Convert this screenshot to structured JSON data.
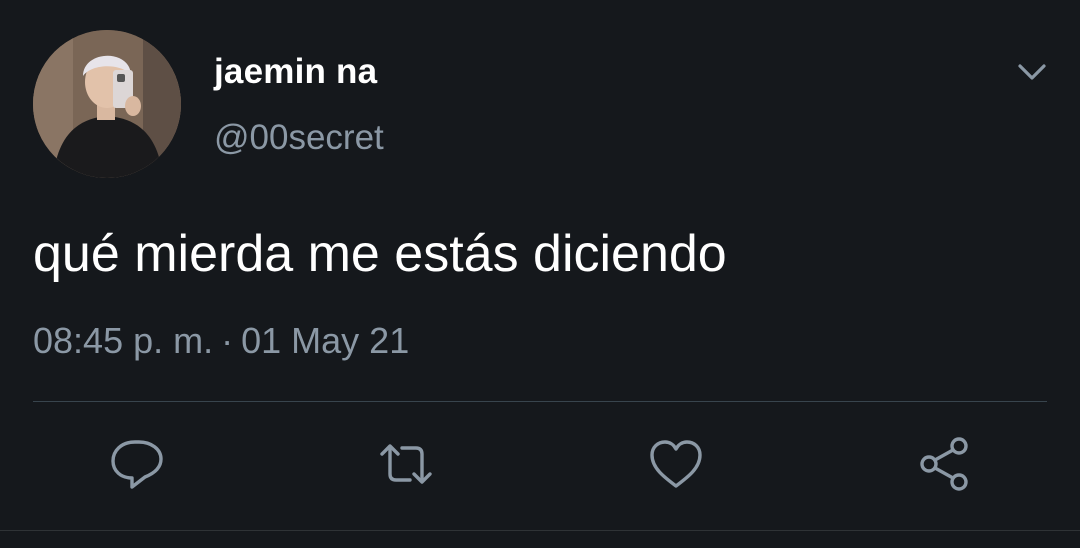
{
  "tweet": {
    "display_name": "jaemin na",
    "handle": "@00secret",
    "text": "qué mierda me estás diciendo",
    "time": "08:45 p. m.",
    "separator": "·",
    "date": "01 May 21"
  },
  "icons": {
    "menu": "chevron-down-icon",
    "reply": "reply-icon",
    "retweet": "retweet-icon",
    "like": "heart-icon",
    "share": "share-icon"
  },
  "colors": {
    "background": "#15181c",
    "primary_text": "#ffffff",
    "secondary_text": "#8b98a5",
    "divider": "#38444d"
  }
}
